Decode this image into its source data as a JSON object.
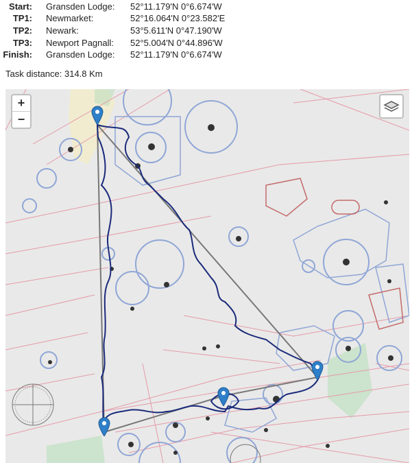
{
  "task": {
    "turnpoints": [
      {
        "label": "Start:",
        "name": "Gransden Lodge:",
        "coord": "52°11.179'N 0°6.674'W"
      },
      {
        "label": "TP1:",
        "name": "Newmarket:",
        "coord": "52°16.064'N 0°23.582'E"
      },
      {
        "label": "TP2:",
        "name": "Newark:",
        "coord": "53°5.611'N 0°47.190'W"
      },
      {
        "label": "TP3:",
        "name": "Newport Pagnall:",
        "coord": "52°5.004'N 0°44.896'W"
      },
      {
        "label": "Finish:",
        "name": "Gransden Lodge:",
        "coord": "52°11.179'N 0°6.674'W"
      }
    ],
    "distance": "Task distance: 314.8 Km"
  },
  "map": {
    "zoom_in": "+",
    "zoom_out": "−",
    "layers_icon": "layers-icon",
    "marker_icon": "map-pin-icon",
    "colors": {
      "airspace": "#e07b8c",
      "atz": "#8fa6d6",
      "track": "#1a2a7a",
      "task_line": "#777777",
      "marker": "#2f7fc9",
      "danger": "#c46a6a"
    }
  }
}
